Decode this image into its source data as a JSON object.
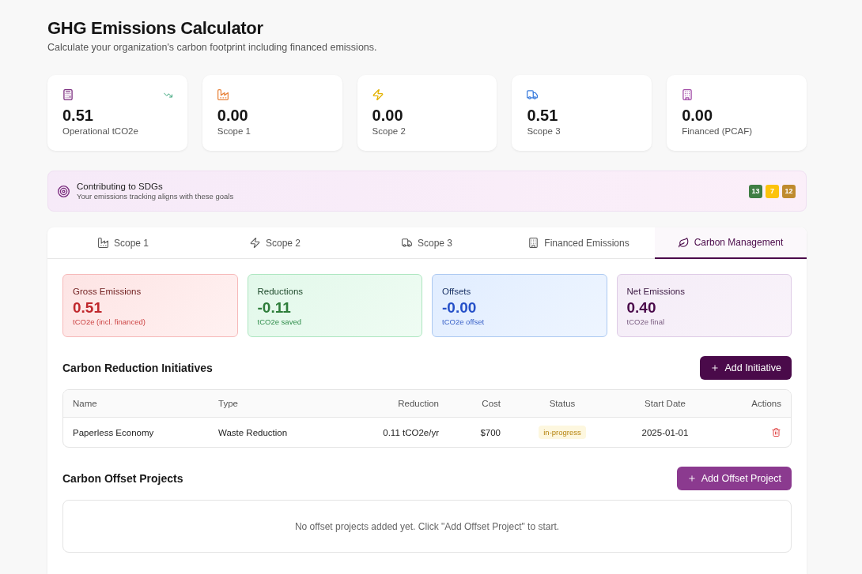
{
  "header": {
    "title": "GHG Emissions Calculator",
    "subtitle": "Calculate your organization's carbon footprint including financed emissions."
  },
  "stats": [
    {
      "kind": "operational",
      "value": "0.51",
      "label": "Operational tCO2e",
      "trend_down": true
    },
    {
      "kind": "scope1",
      "value": "0.00",
      "label": "Scope 1",
      "trend_down": false
    },
    {
      "kind": "scope2",
      "value": "0.00",
      "label": "Scope 2",
      "trend_down": false
    },
    {
      "kind": "scope3",
      "value": "0.51",
      "label": "Scope 3",
      "trend_down": false
    },
    {
      "kind": "financed",
      "value": "0.00",
      "label": "Financed (PCAF)",
      "trend_down": false
    }
  ],
  "sdg_banner": {
    "title": "Contributing to SDGs",
    "subtitle": "Your emissions tracking aligns with these goals",
    "goals": [
      {
        "number": "13",
        "color": "#3f7e44"
      },
      {
        "number": "7",
        "color": "#fcc30b"
      },
      {
        "number": "12",
        "color": "#bf8b2e"
      }
    ]
  },
  "tabs": [
    {
      "kind": "scope1",
      "label": "Scope 1",
      "selected": false
    },
    {
      "kind": "scope2",
      "label": "Scope 2",
      "selected": false
    },
    {
      "kind": "scope3",
      "label": "Scope 3",
      "selected": false
    },
    {
      "kind": "financed",
      "label": "Financed Emissions",
      "selected": false
    },
    {
      "kind": "management",
      "label": "Carbon Management",
      "selected": true
    }
  ],
  "carbon_management": {
    "summary": [
      {
        "kind": "gross",
        "title": "Gross Emissions",
        "value": "0.51",
        "unit": "tCO2e (incl. financed)"
      },
      {
        "kind": "reductions",
        "title": "Reductions",
        "value": "-0.11",
        "unit": "tCO2e saved"
      },
      {
        "kind": "offsets",
        "title": "Offsets",
        "value": "-0.00",
        "unit": "tCO2e offset"
      },
      {
        "kind": "net",
        "title": "Net Emissions",
        "value": "0.40",
        "unit": "tCO2e final"
      }
    ],
    "initiatives": {
      "title": "Carbon Reduction Initiatives",
      "button": "Add Initiative",
      "columns": [
        "Name",
        "Type",
        "Reduction",
        "Cost",
        "Status",
        "Start Date",
        "Actions"
      ],
      "rows": [
        {
          "name": "Paperless Economy",
          "type": "Waste Reduction",
          "reduction": "0.11 tCO2e/yr",
          "cost": "$700",
          "status": "in-progress",
          "start_date": "2025-01-01"
        }
      ]
    },
    "offsets": {
      "title": "Carbon Offset Projects",
      "button": "Add Offset Project",
      "empty_message": "No offset projects added yet. Click \"Add Offset Project\" to start."
    }
  }
}
